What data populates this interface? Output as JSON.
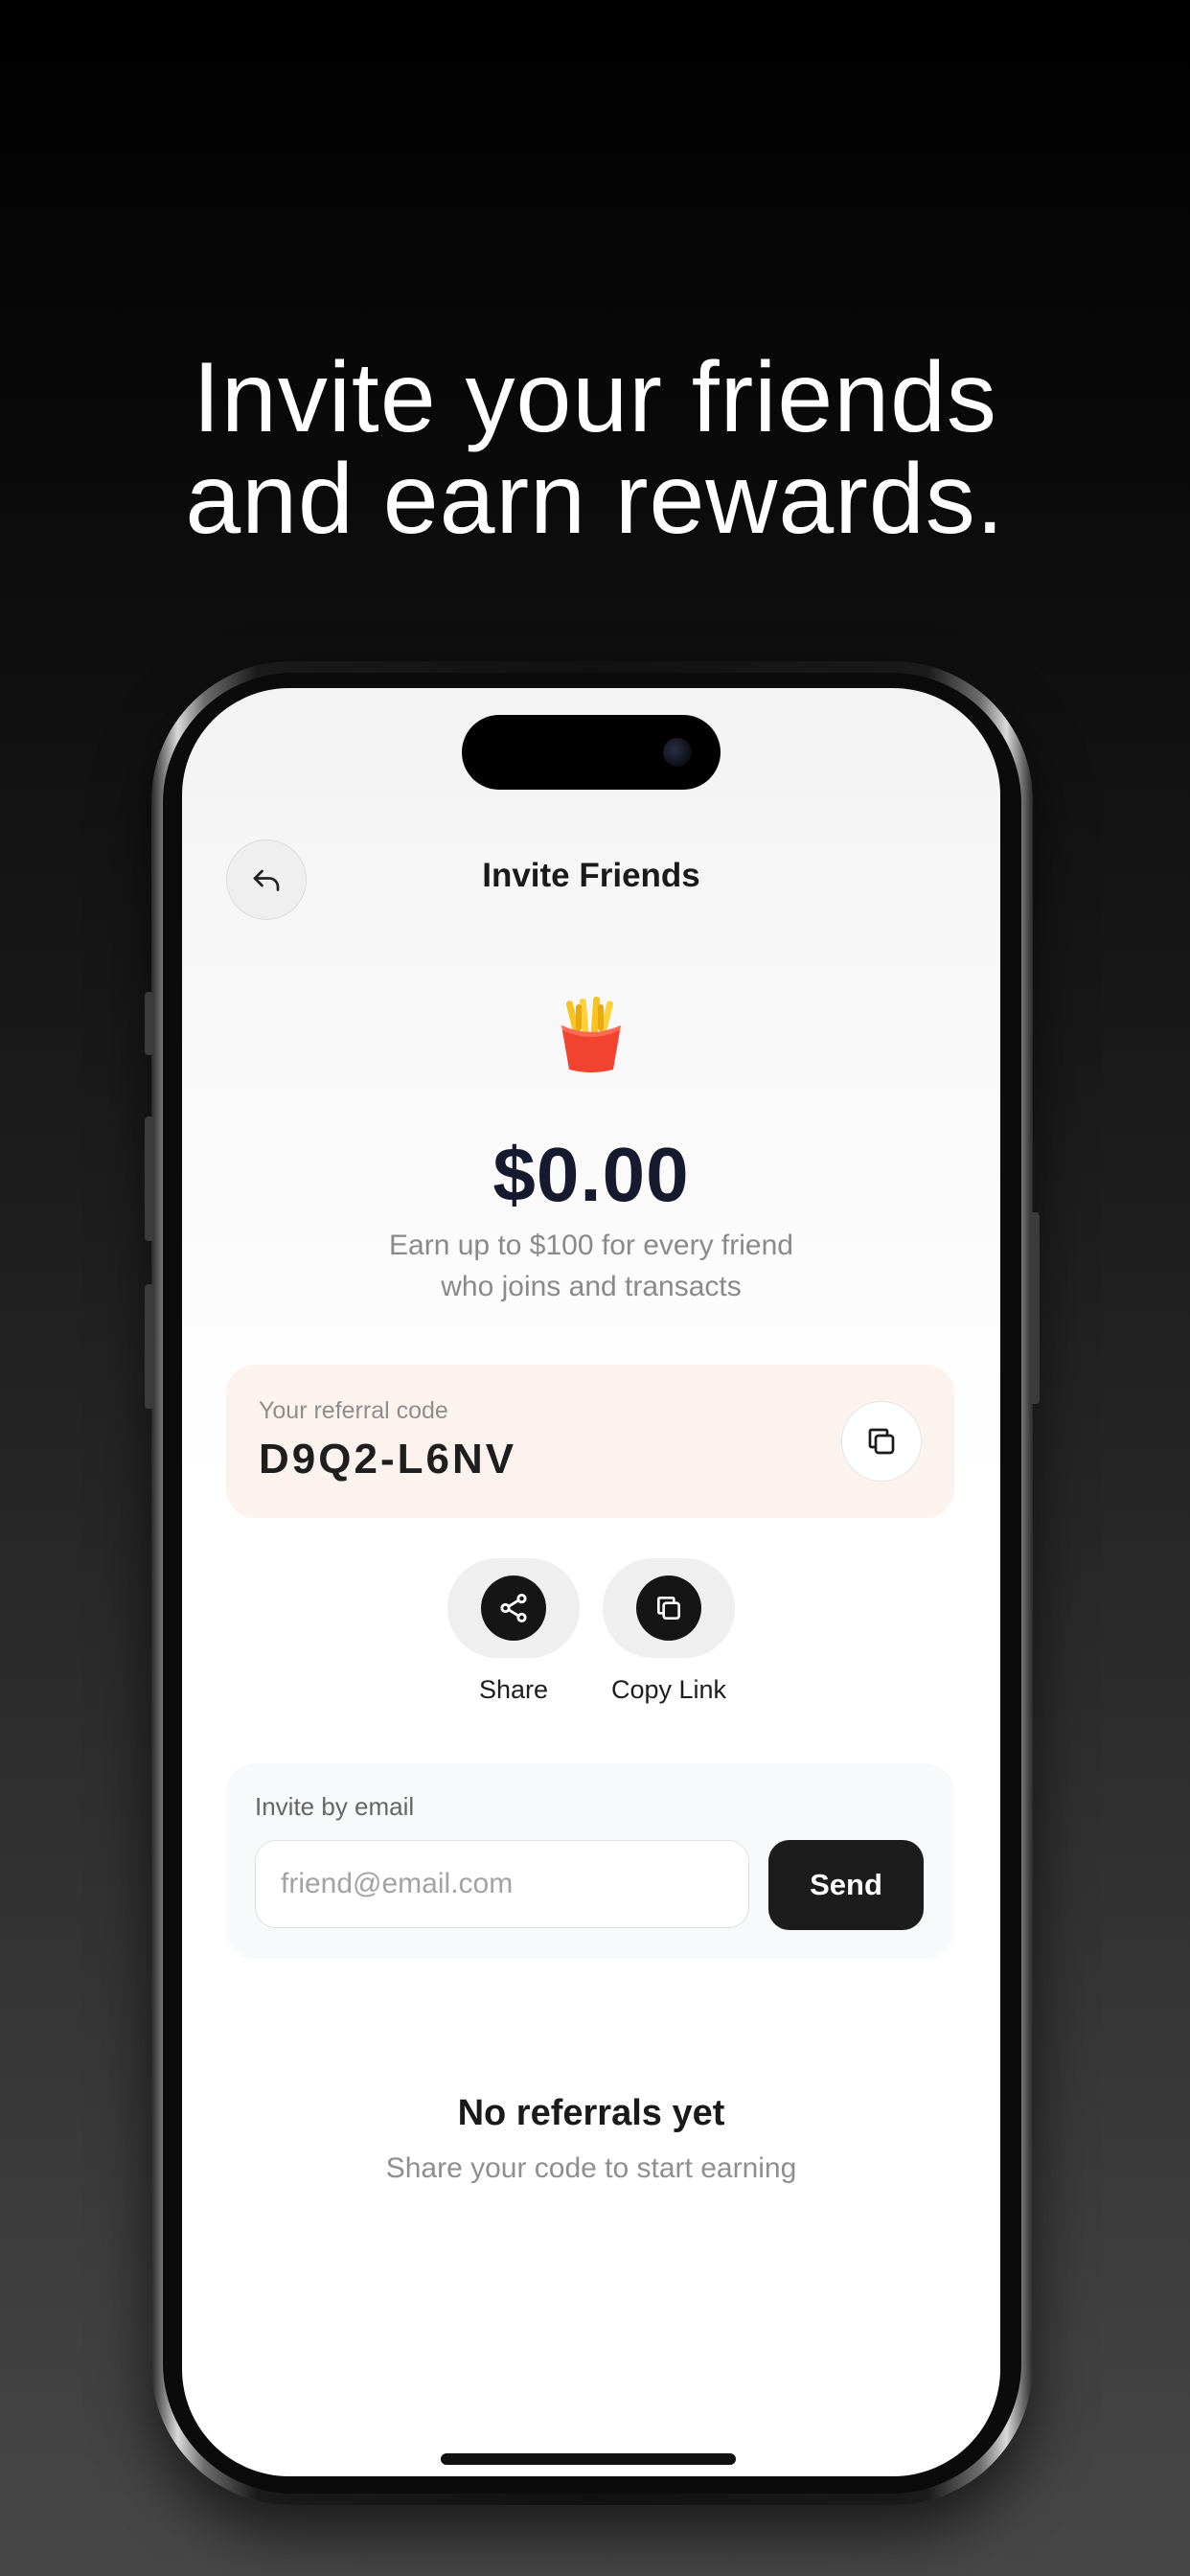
{
  "headline": {
    "line1": "Invite your friends",
    "line2": "and earn rewards."
  },
  "nav": {
    "title": "Invite Friends",
    "back_icon": "back-arrow-icon"
  },
  "hero": {
    "emoji_icon": "french-fries-icon",
    "amount": "$0.00",
    "subtitle_line1": "Earn up to $100 for every friend",
    "subtitle_line2": "who joins and transacts"
  },
  "referral": {
    "label": "Your referral code",
    "code": "D9Q2-L6NV",
    "copy_icon": "copy-icon"
  },
  "actions": [
    {
      "label": "Share",
      "icon": "share-icon"
    },
    {
      "label": "Copy Link",
      "icon": "copy-icon"
    }
  ],
  "email": {
    "label": "Invite by email",
    "placeholder": "friend@email.com",
    "value": "",
    "send_label": "Send"
  },
  "empty_state": {
    "title": "No referrals yet",
    "subtitle": "Share your code to start earning"
  },
  "colors": {
    "card_bg": "#fdf3ee",
    "dark": "#1c1c1c",
    "amount": "#161a2e"
  }
}
